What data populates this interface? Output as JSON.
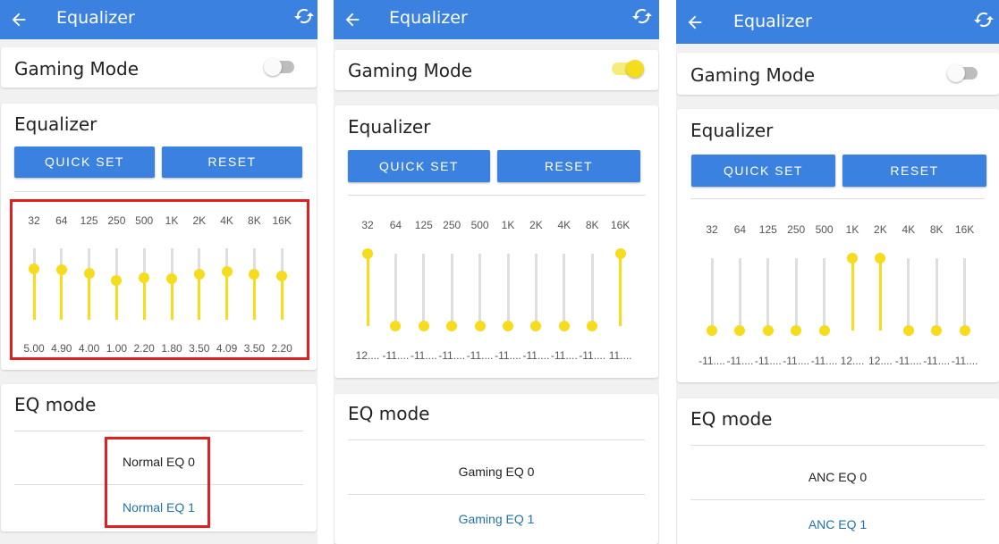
{
  "screens": [
    {
      "title": "Equalizer",
      "gaming_mode_label": "Gaming Mode",
      "gaming_mode_on": false,
      "eq_title": "Equalizer",
      "quick_set_label": "QUICK SET",
      "reset_label": "RESET",
      "bands": [
        "32",
        "64",
        "125",
        "250",
        "500",
        "1K",
        "2K",
        "4K",
        "8K",
        "16K"
      ],
      "values": [
        "5.00",
        "4.90",
        "4.00",
        "1.00",
        "2.20",
        "1.80",
        "3.50",
        "4.09",
        "3.50",
        "2.20"
      ],
      "levels": [
        0.71,
        0.7,
        0.65,
        0.55,
        0.59,
        0.57,
        0.64,
        0.67,
        0.64,
        0.61
      ],
      "eq_mode_title": "EQ mode",
      "modes": [
        "Normal EQ 0",
        "Normal EQ 1"
      ],
      "selected_mode": 1
    },
    {
      "title": "Equalizer",
      "gaming_mode_label": "Gaming Mode",
      "gaming_mode_on": true,
      "eq_title": "Equalizer",
      "quick_set_label": "QUICK SET",
      "reset_label": "RESET",
      "bands": [
        "32",
        "64",
        "125",
        "250",
        "500",
        "1K",
        "2K",
        "4K",
        "8K",
        "16K"
      ],
      "values": [
        "12....",
        "-11....",
        "-11....",
        "-11....",
        "-11....",
        "-11....",
        "-11....",
        "-11....",
        "-11....",
        "11...."
      ],
      "levels": [
        1.0,
        0.0,
        0.0,
        0.0,
        0.0,
        0.0,
        0.0,
        0.0,
        0.0,
        1.0
      ],
      "eq_mode_title": "EQ mode",
      "modes": [
        "Gaming EQ 0",
        "Gaming EQ 1"
      ],
      "selected_mode": 1
    },
    {
      "title": "Equalizer",
      "gaming_mode_label": "Gaming Mode",
      "gaming_mode_on": false,
      "eq_title": "Equalizer",
      "quick_set_label": "QUICK SET",
      "reset_label": "RESET",
      "bands": [
        "32",
        "64",
        "125",
        "250",
        "500",
        "1K",
        "2K",
        "4K",
        "8K",
        "16K"
      ],
      "values": [
        "-11....",
        "-11....",
        "-11....",
        "-11....",
        "-11....",
        "12....",
        "12....",
        "-11....",
        "-11....",
        "-11...."
      ],
      "levels": [
        0.0,
        0.0,
        0.0,
        0.0,
        0.0,
        1.0,
        1.0,
        0.0,
        0.0,
        0.0
      ],
      "eq_mode_title": "EQ mode",
      "modes": [
        "ANC EQ 0",
        "ANC EQ 1"
      ],
      "selected_mode": 1
    }
  ],
  "colors": {
    "appbar": "#3b82e0",
    "slider_fill": "#f5dc1c",
    "selected_mode": "#1f73a8",
    "highlight": "#e02020"
  }
}
